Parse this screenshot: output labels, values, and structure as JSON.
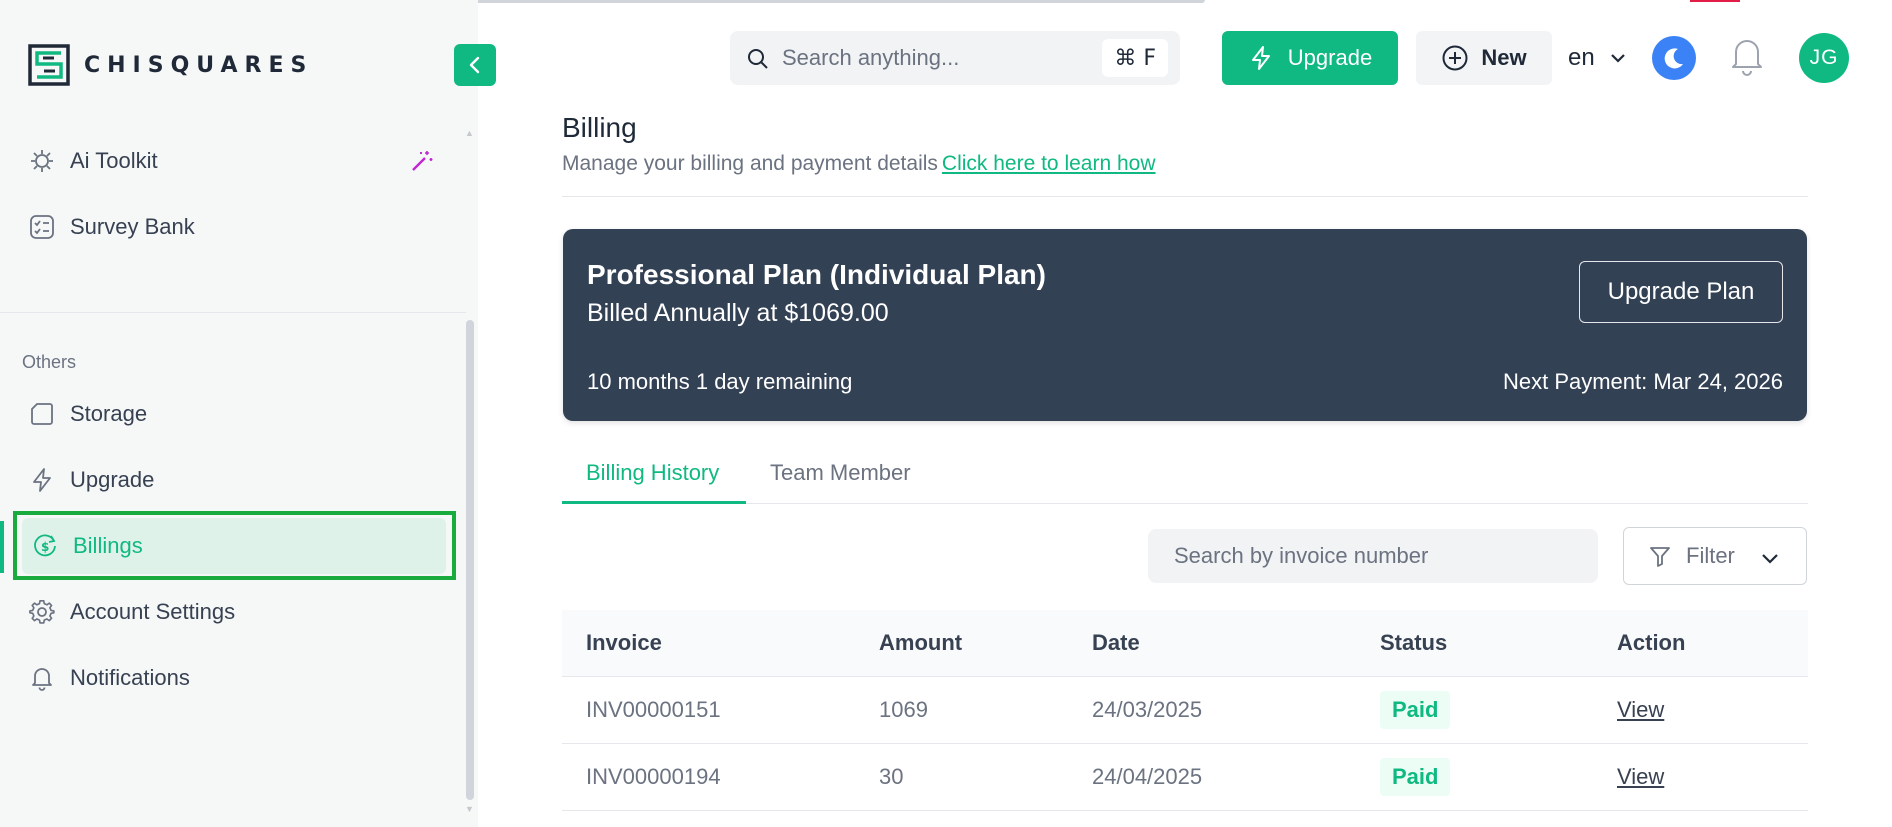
{
  "brand": {
    "name": "CHISQUARES",
    "accent": "#10b981",
    "sidebar_bg": "#f6f8f8",
    "card_bg": "#334155"
  },
  "sidebar": {
    "top_items": [
      {
        "label": "Ai Toolkit",
        "icon": "ai-toolkit-icon"
      },
      {
        "label": "Survey Bank",
        "icon": "survey-bank-icon"
      }
    ],
    "section_label": "Others",
    "items": [
      {
        "label": "Storage",
        "icon": "storage-icon"
      },
      {
        "label": "Upgrade",
        "icon": "lightning-icon"
      },
      {
        "label": "Billings",
        "icon": "billing-icon",
        "active": true
      },
      {
        "label": "Account Settings",
        "icon": "gear-icon"
      },
      {
        "label": "Notifications",
        "icon": "bell-icon"
      }
    ]
  },
  "header": {
    "search_placeholder": "Search anything...",
    "search_shortcut": "⌘ F",
    "upgrade_label": "Upgrade",
    "new_label": "New",
    "language": "en",
    "avatar_initials": "JG"
  },
  "main": {
    "title": "Billing",
    "subtitle": "Manage your billing and payment details",
    "learn_link": "Click here to learn how",
    "plan": {
      "name": "Professional Plan (Individual Plan)",
      "billed": "Billed Annually at $1069.00",
      "remaining": "10 months 1 day remaining",
      "next_payment": "Next Payment: Mar 24, 2026",
      "upgrade_button": "Upgrade Plan"
    },
    "tabs": [
      {
        "label": "Billing History",
        "active": true
      },
      {
        "label": "Team Member",
        "active": false
      }
    ],
    "invoice_search_placeholder": "Search by invoice number",
    "filter_label": "Filter",
    "table": {
      "columns": [
        "Invoice",
        "Amount",
        "Date",
        "Status",
        "Action"
      ],
      "rows": [
        {
          "invoice": "INV00000151",
          "amount": "1069",
          "date": "24/03/2025",
          "status": "Paid",
          "action": "View"
        },
        {
          "invoice": "INV00000194",
          "amount": "30",
          "date": "24/04/2025",
          "status": "Paid",
          "action": "View"
        }
      ]
    }
  }
}
